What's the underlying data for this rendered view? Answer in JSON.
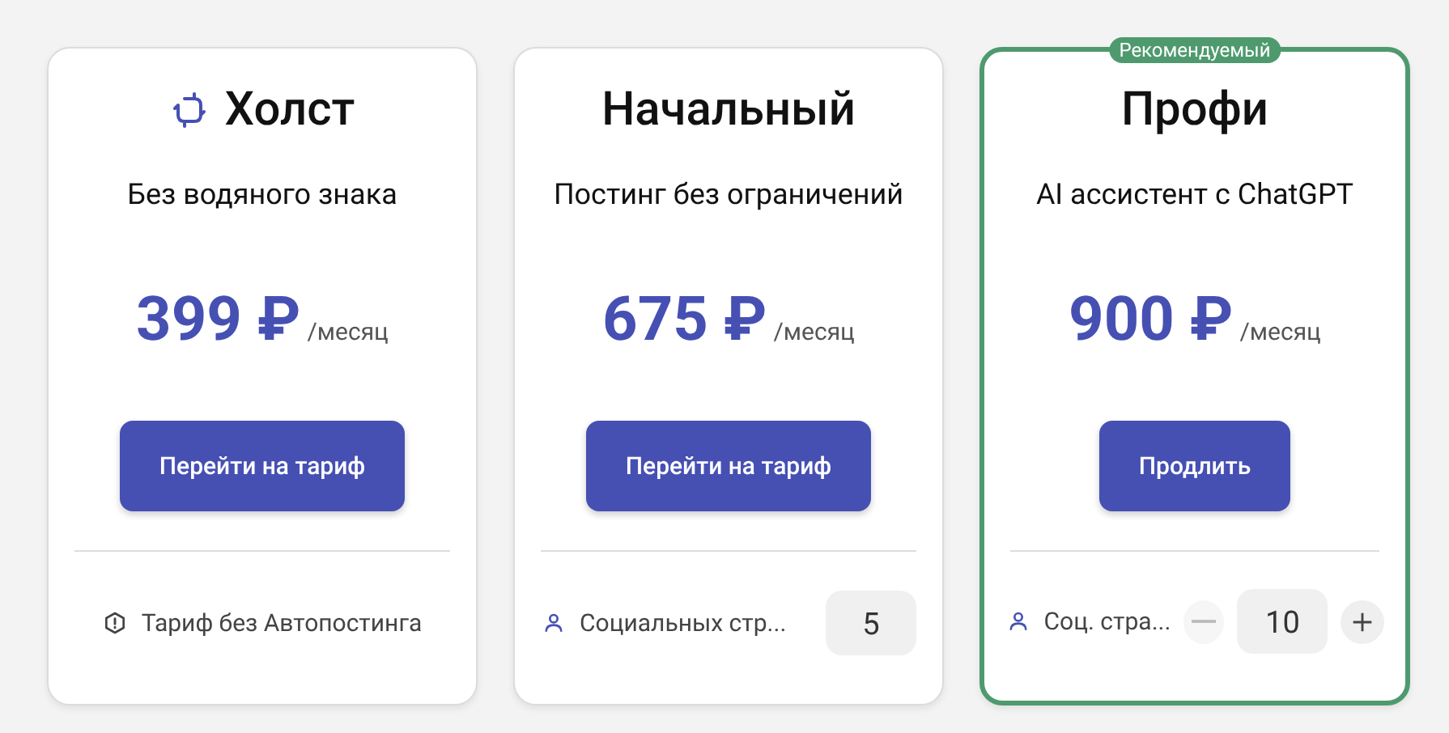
{
  "plans": [
    {
      "name": "Холст",
      "has_logo": true,
      "recommended": false,
      "subtitle": "Без водяного знака",
      "price": "399 ₽",
      "period": "/месяц",
      "button": "Перейти на тариф",
      "footer": {
        "kind": "note",
        "text": "Тариф без Автопостинга"
      }
    },
    {
      "name": "Начальный",
      "has_logo": false,
      "recommended": false,
      "subtitle": "Постинг без ограничений",
      "price": "675 ₽",
      "period": "/месяц",
      "button": "Перейти на тариф",
      "footer": {
        "kind": "counter",
        "text": "Социальных стр...",
        "value": "5",
        "stepper": false
      }
    },
    {
      "name": "Профи",
      "has_logo": false,
      "recommended": true,
      "badge": "Рекомендуемый",
      "subtitle": "AI ассистент с ChatGPT",
      "price": "900 ₽",
      "period": "/месяц",
      "button": "Продлить",
      "footer": {
        "kind": "counter",
        "text": "Соц. стра...",
        "value": "10",
        "stepper": true,
        "minus_disabled": true
      }
    }
  ]
}
